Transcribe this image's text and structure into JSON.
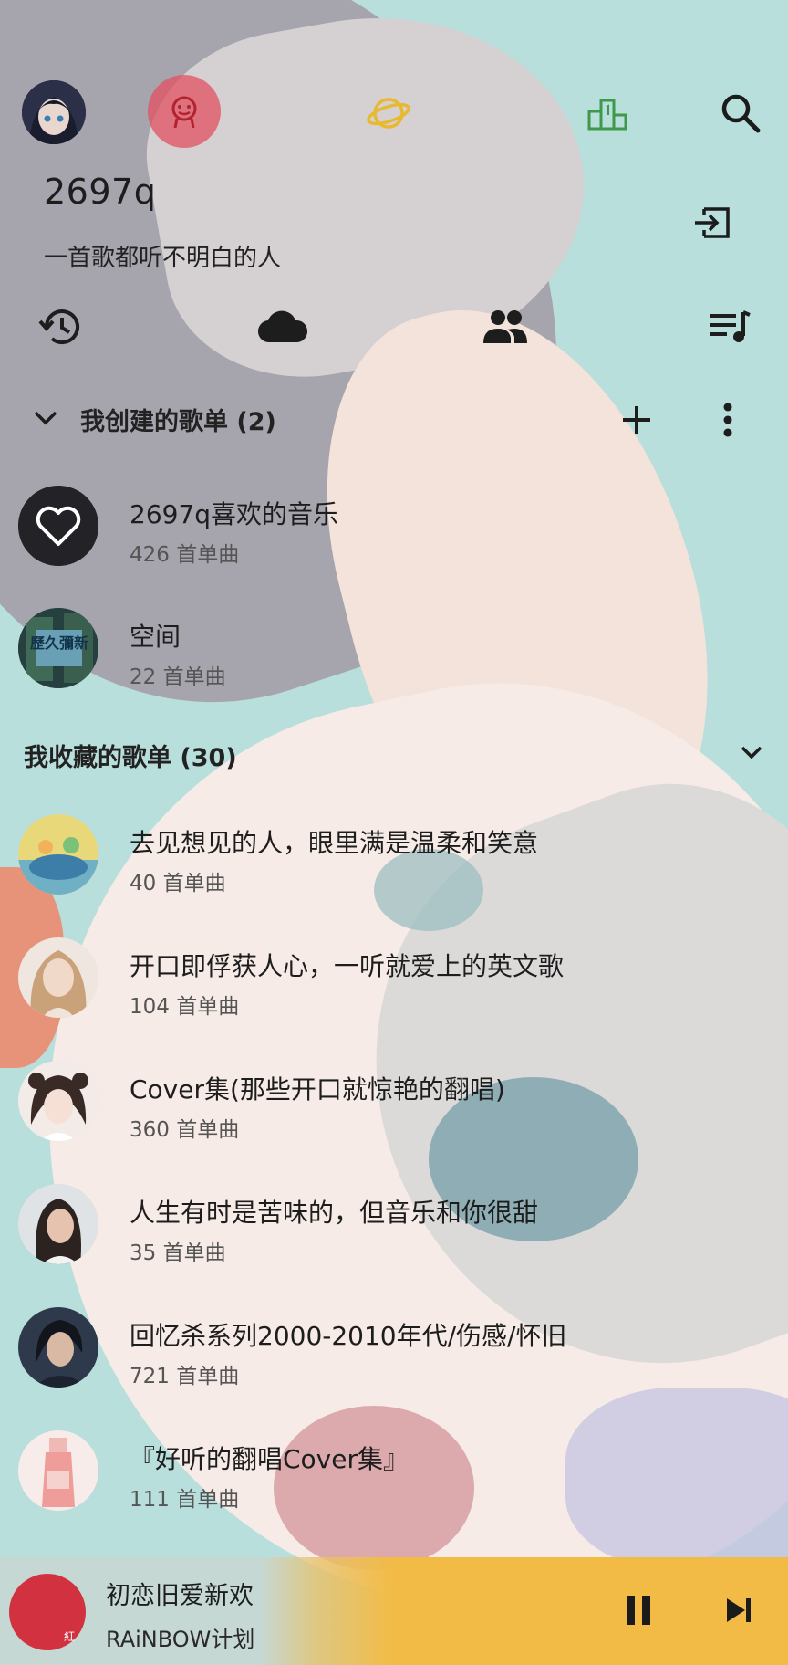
{
  "header": {
    "icons": [
      "avatar",
      "user-face-icon",
      "planet-icon",
      "podium-icon",
      "search-icon"
    ],
    "accent_colors": {
      "active_tab": "#e25062",
      "planet": "#e8b930",
      "podium": "#3e9a4a"
    }
  },
  "profile": {
    "username": "2697q",
    "signature": "一首歌都听不明白的人"
  },
  "quick_actions": [
    "history-icon",
    "cloud-icon",
    "friends-icon",
    "playlist-queue-icon"
  ],
  "created_section": {
    "title": "我创建的歌单 (2)",
    "playlists": [
      {
        "title": "2697q喜欢的音乐",
        "count": "426 首单曲",
        "cover_label": "heart-cover"
      },
      {
        "title": "空间",
        "count": "22 首单曲",
        "cover_label": "album-cover",
        "cover_text": "歷久彌新"
      }
    ]
  },
  "collected_section": {
    "title": "我收藏的歌单 (30)",
    "playlists": [
      {
        "title": "去见想见的人，眼里满是温柔和笑意",
        "count": "40 首单曲"
      },
      {
        "title": "开口即俘获人心，一听就爱上的英文歌",
        "count": "104 首单曲"
      },
      {
        "title": "Cover集(那些开口就惊艳的翻唱)",
        "count": "360 首单曲"
      },
      {
        "title": "人生有时是苦味的，但音乐和你很甜",
        "count": "35 首单曲"
      },
      {
        "title": "回忆杀系列2000-2010年代/伤感/怀旧",
        "count": "721 首单曲"
      },
      {
        "title": "『好听的翻唱Cover集』",
        "count": "111 首单曲"
      }
    ]
  },
  "player": {
    "song": "初恋旧爱新欢",
    "artist": "RAiNBOW计划",
    "disc_text": "紅",
    "progress": 0.45,
    "progress_color": "#f2bb45"
  }
}
